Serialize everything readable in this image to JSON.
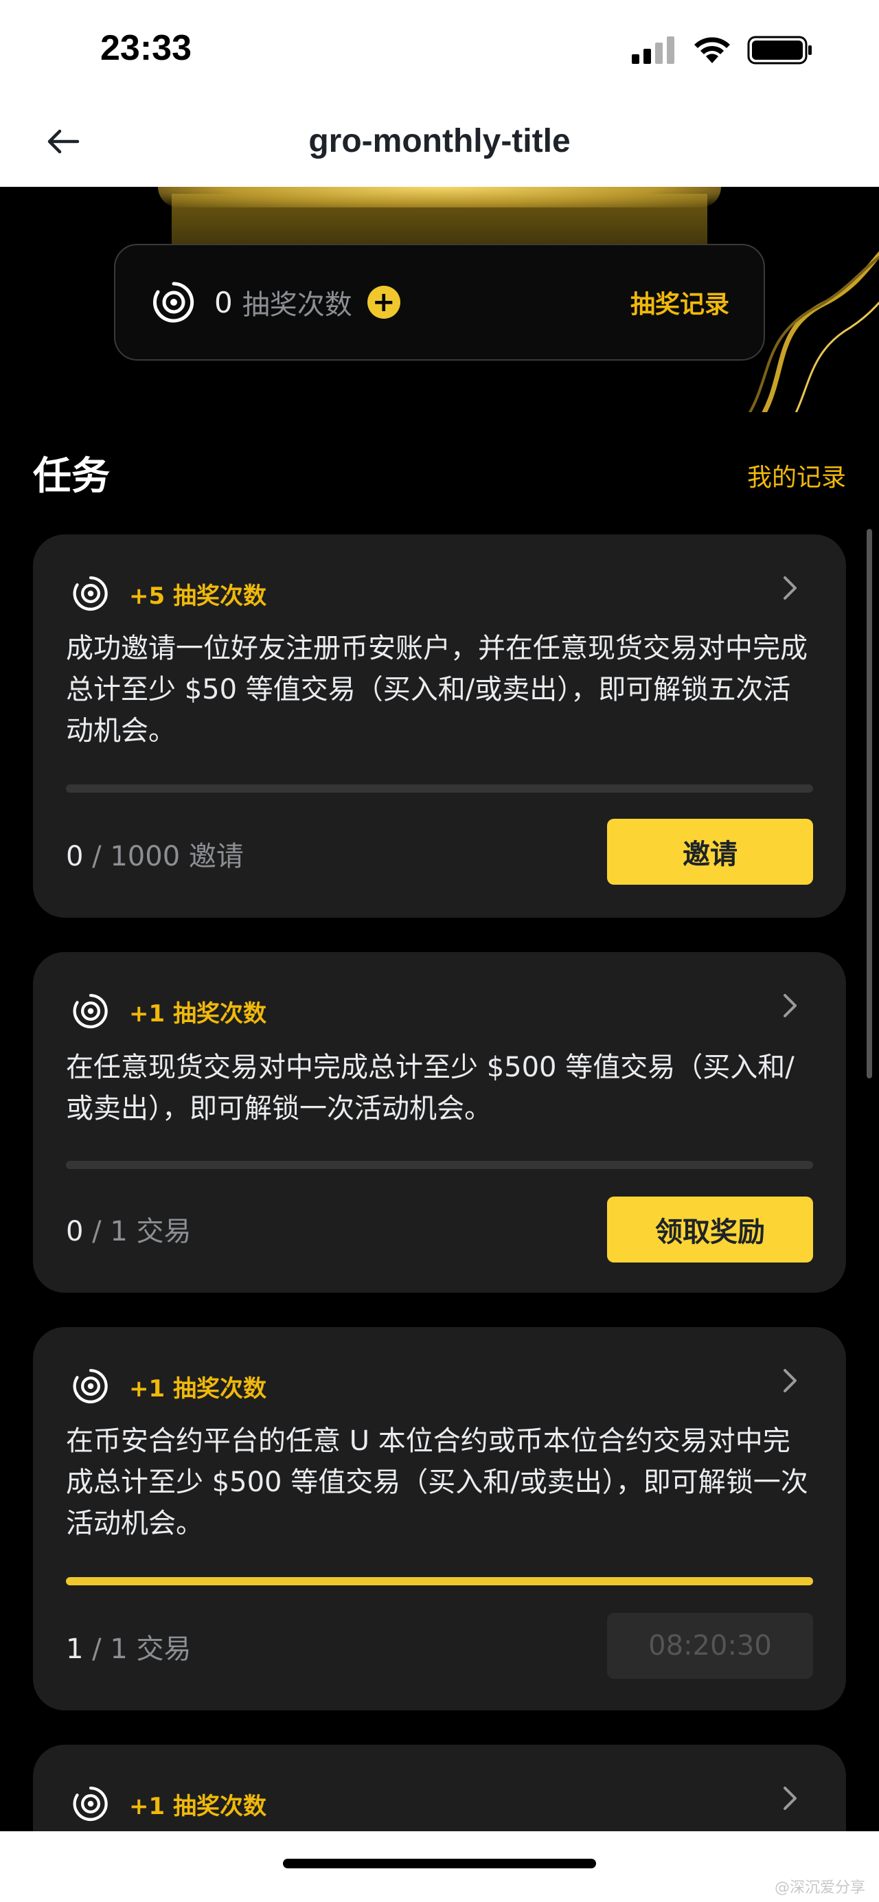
{
  "status_bar": {
    "time": "23:33"
  },
  "nav": {
    "title": "gro-monthly-title"
  },
  "draws": {
    "count": "0",
    "label": "抽奖次数",
    "plus": "+",
    "history_link": "抽奖记录"
  },
  "section": {
    "title": "任务",
    "my_records_link": "我的记录"
  },
  "tasks": [
    {
      "reward": "+5 抽奖次数",
      "description": "成功邀请一位好友注册币安账户，并在任意现货交易对中完成总计至少 $50 等值交易（买入和/或卖出），即可解锁五次活动机会。",
      "progress_current": "0",
      "progress_rest": " / 1000 邀请",
      "progress_fraction": 0,
      "button": "邀请"
    },
    {
      "reward": "+1 抽奖次数",
      "description": "在任意现货交易对中完成总计至少 $500 等值交易（买入和/或卖出），即可解锁一次活动机会。",
      "progress_current": "0",
      "progress_rest": " / 1 交易",
      "progress_fraction": 0,
      "button": "领取奖励"
    },
    {
      "reward": "+1 抽奖次数",
      "description": "在币安合约平台的任意 U 本位合约或币本位合约交易对中完成总计至少 $500 等值交易（买入和/或卖出），即可解锁一次活动机会。",
      "progress_current": "1",
      "progress_rest": " / 1 交易",
      "progress_fraction": 1,
      "button": "08:20:30"
    },
    {
      "reward": "+1 抽奖次数"
    }
  ],
  "watermark": "@深沉爱分享",
  "colors": {
    "accent": "#f0b90b",
    "button": "#fcd535",
    "card": "#1e1e1e"
  }
}
